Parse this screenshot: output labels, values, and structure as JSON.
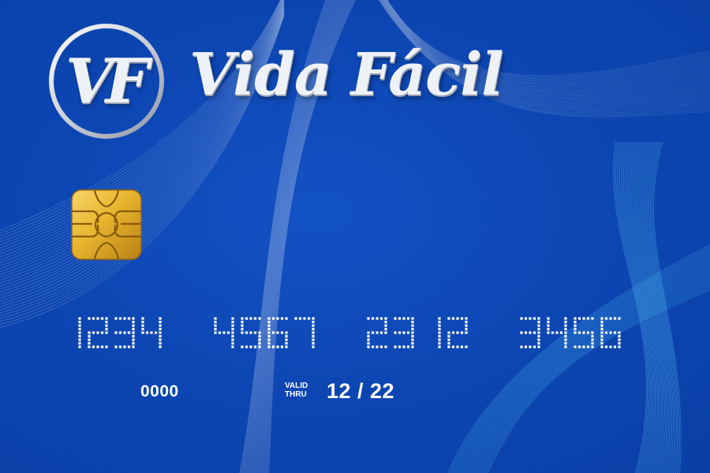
{
  "brand": {
    "initials": "VF",
    "name": "Vida Fácil"
  },
  "card": {
    "number_groups": [
      "1234",
      "4567",
      "2312",
      "3456"
    ],
    "holder": "0000",
    "valid_thru_line1": "VALID",
    "valid_thru_line2": "THRU",
    "expiry": "12 / 22"
  },
  "colors": {
    "background": "#0d47b4",
    "chip_gold": "#e8b52e",
    "text": "#ffffff",
    "logo_silver": "#eef1f6"
  }
}
